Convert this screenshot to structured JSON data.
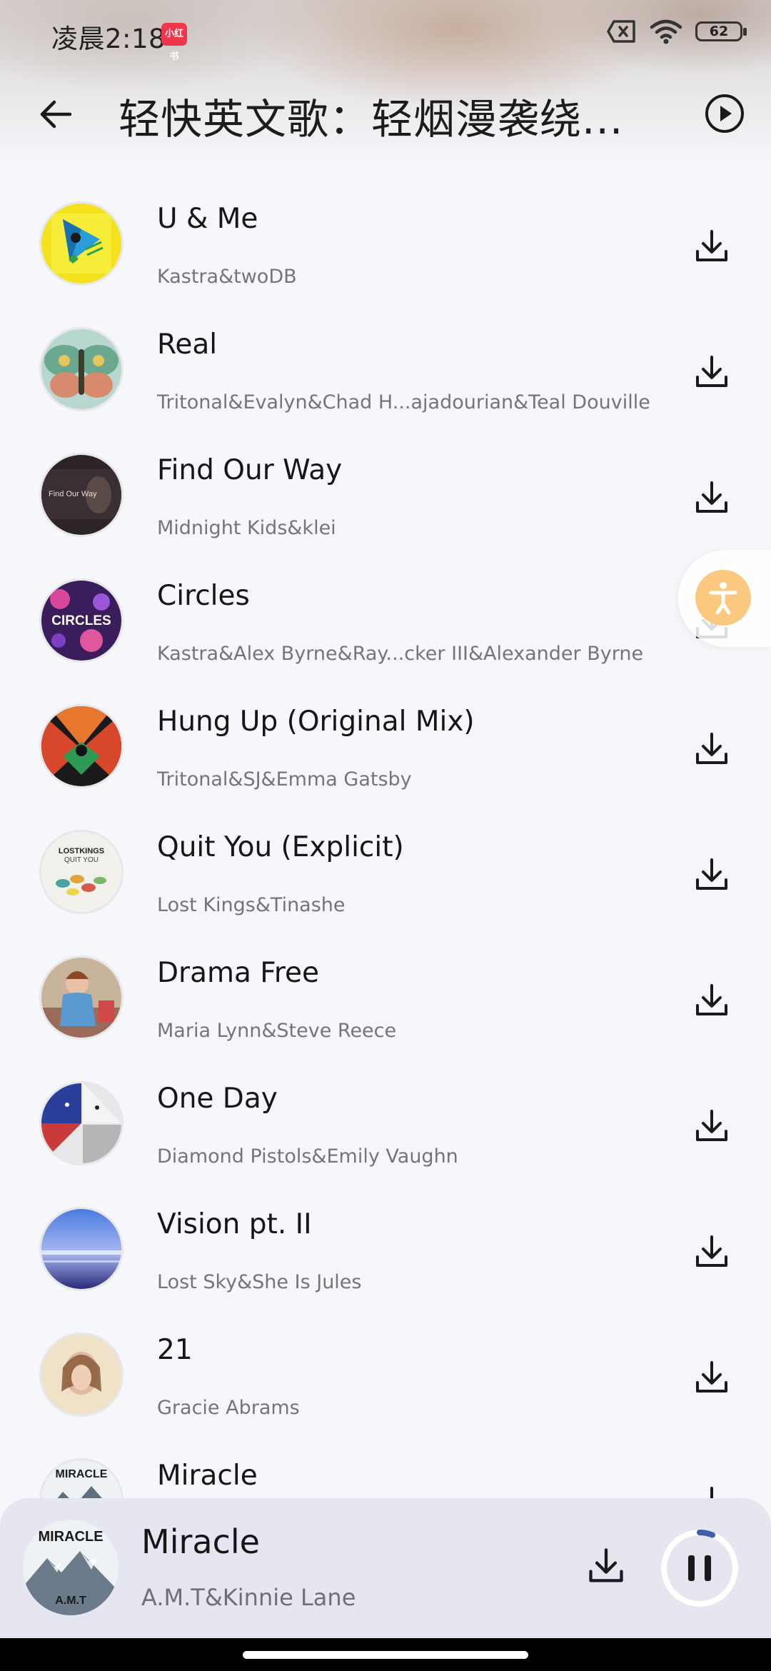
{
  "status_bar": {
    "time": "凌晨2:18",
    "badge": "小红书",
    "battery": "62"
  },
  "header": {
    "title": "轻快英文歌：轻烟漫袭绕..."
  },
  "songs": [
    {
      "title": "U & Me",
      "artist": "Kastra&twoDB"
    },
    {
      "title": "Real",
      "artist": "Tritonal&Evalyn&Chad H...ajadourian&Teal Douville"
    },
    {
      "title": "Find Our Way",
      "artist": "Midnight Kids&klei"
    },
    {
      "title": "Circles",
      "artist": "Kastra&Alex Byrne&Ray...cker III&Alexander Byrne"
    },
    {
      "title": "Hung Up (Original Mix)",
      "artist": "Tritonal&SJ&Emma Gatsby"
    },
    {
      "title": "Quit You (Explicit)",
      "artist": "Lost Kings&Tinashe"
    },
    {
      "title": "Drama Free",
      "artist": "Maria Lynn&Steve Reece"
    },
    {
      "title": "One Day",
      "artist": "Diamond Pistols&Emily Vaughn"
    },
    {
      "title": "Vision pt. II",
      "artist": "Lost Sky&She Is Jules"
    },
    {
      "title": "21",
      "artist": "Gracie Abrams"
    },
    {
      "title": "Miracle",
      "artist": ""
    }
  ],
  "cover_art_text": {
    "find_our_way": "Find Our Way",
    "circles": "CIRCLES",
    "quit_you_line1": "LOSTKINGS",
    "quit_you_line2": "QUIT YOU",
    "miracle": "MIRACLE",
    "miracle_artist": "A.M.T"
  },
  "now_playing": {
    "title": "Miracle",
    "artist": "A.M.T&Kinnie Lane",
    "cover_text": "MIRACLE",
    "cover_subtext": "A.M.T"
  },
  "colors": {
    "accent_orange": "#fbc880",
    "player_bg": "#e5e6ef",
    "progress_ring": "#3d5ea8"
  }
}
